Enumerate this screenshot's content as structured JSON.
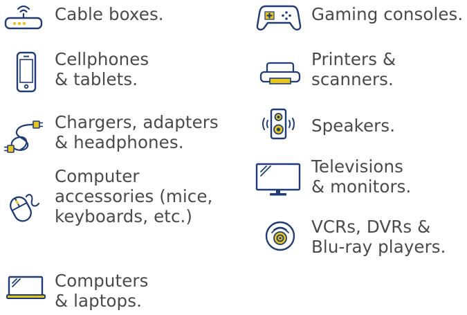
{
  "palette": {
    "icon_navy": "#1f3c74",
    "icon_yellow": "#e7c51f",
    "text": "#4a4a4a"
  },
  "items": [
    {
      "icon": "cable-box-icon",
      "lines": [
        "Cable boxes."
      ]
    },
    {
      "icon": "cellphone-icon",
      "lines": [
        "Cellphones",
        "& tablets."
      ]
    },
    {
      "icon": "charger-cable-icon",
      "lines": [
        "Chargers, adapters",
        "& headphones."
      ]
    },
    {
      "icon": "computer-mouse-icon",
      "lines": [
        "Computer",
        "accessories (mice,",
        "keyboards, etc.)"
      ]
    },
    {
      "icon": "laptop-icon",
      "lines": [
        "Computers",
        "& laptops."
      ]
    },
    {
      "icon": "game-controller-icon",
      "lines": [
        "Gaming consoles."
      ]
    },
    {
      "icon": "printer-icon",
      "lines": [
        "Printers &",
        "scanners."
      ]
    },
    {
      "icon": "speaker-icon",
      "lines": [
        "Speakers."
      ]
    },
    {
      "icon": "monitor-icon",
      "lines": [
        "Televisions",
        "& monitors."
      ]
    },
    {
      "icon": "disc-player-icon",
      "lines": [
        "VCRs, DVRs &",
        "Blu-ray players."
      ]
    }
  ]
}
